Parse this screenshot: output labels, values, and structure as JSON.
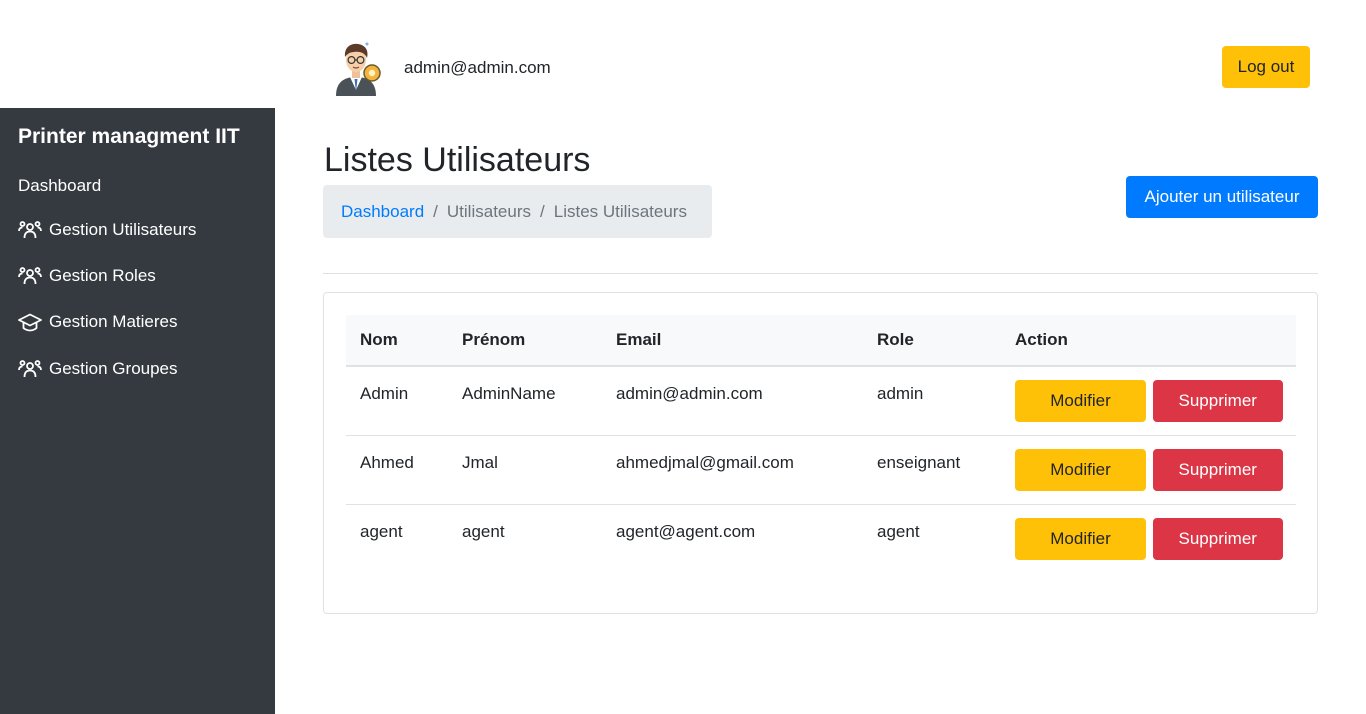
{
  "sidebar": {
    "brand": "Printer managment IIT",
    "items": [
      {
        "label": "Dashboard",
        "icon": "none"
      },
      {
        "label": "Gestion Utilisateurs",
        "icon": "users-icon"
      },
      {
        "label": "Gestion Roles",
        "icon": "users-icon"
      },
      {
        "label": "Gestion Matieres",
        "icon": "graduation-cap-icon"
      },
      {
        "label": "Gestion Groupes",
        "icon": "users-icon"
      }
    ]
  },
  "header": {
    "user_email": "admin@admin.com",
    "logout_label": "Log out"
  },
  "page": {
    "title": "Listes Utilisateurs",
    "breadcrumb": [
      "Dashboard",
      "Utilisateurs",
      "Listes Utilisateurs"
    ],
    "add_button_label": "Ajouter un utilisateur"
  },
  "table": {
    "columns": [
      "Nom",
      "Prénom",
      "Email",
      "Role",
      "Action"
    ],
    "rows": [
      {
        "nom": "Admin",
        "prenom": "AdminName",
        "email": "admin@admin.com",
        "role": "admin"
      },
      {
        "nom": "Ahmed",
        "prenom": "Jmal",
        "email": "ahmedjmal@gmail.com",
        "role": "enseignant"
      },
      {
        "nom": "agent",
        "prenom": "agent",
        "email": "agent@agent.com",
        "role": "agent"
      }
    ],
    "modify_label": "Modifier",
    "delete_label": "Supprimer"
  },
  "colors": {
    "sidebar_bg": "#343a40",
    "warning": "#ffc107",
    "danger": "#dc3545",
    "primary": "#007bff",
    "breadcrumb_bg": "#e9ecef"
  }
}
